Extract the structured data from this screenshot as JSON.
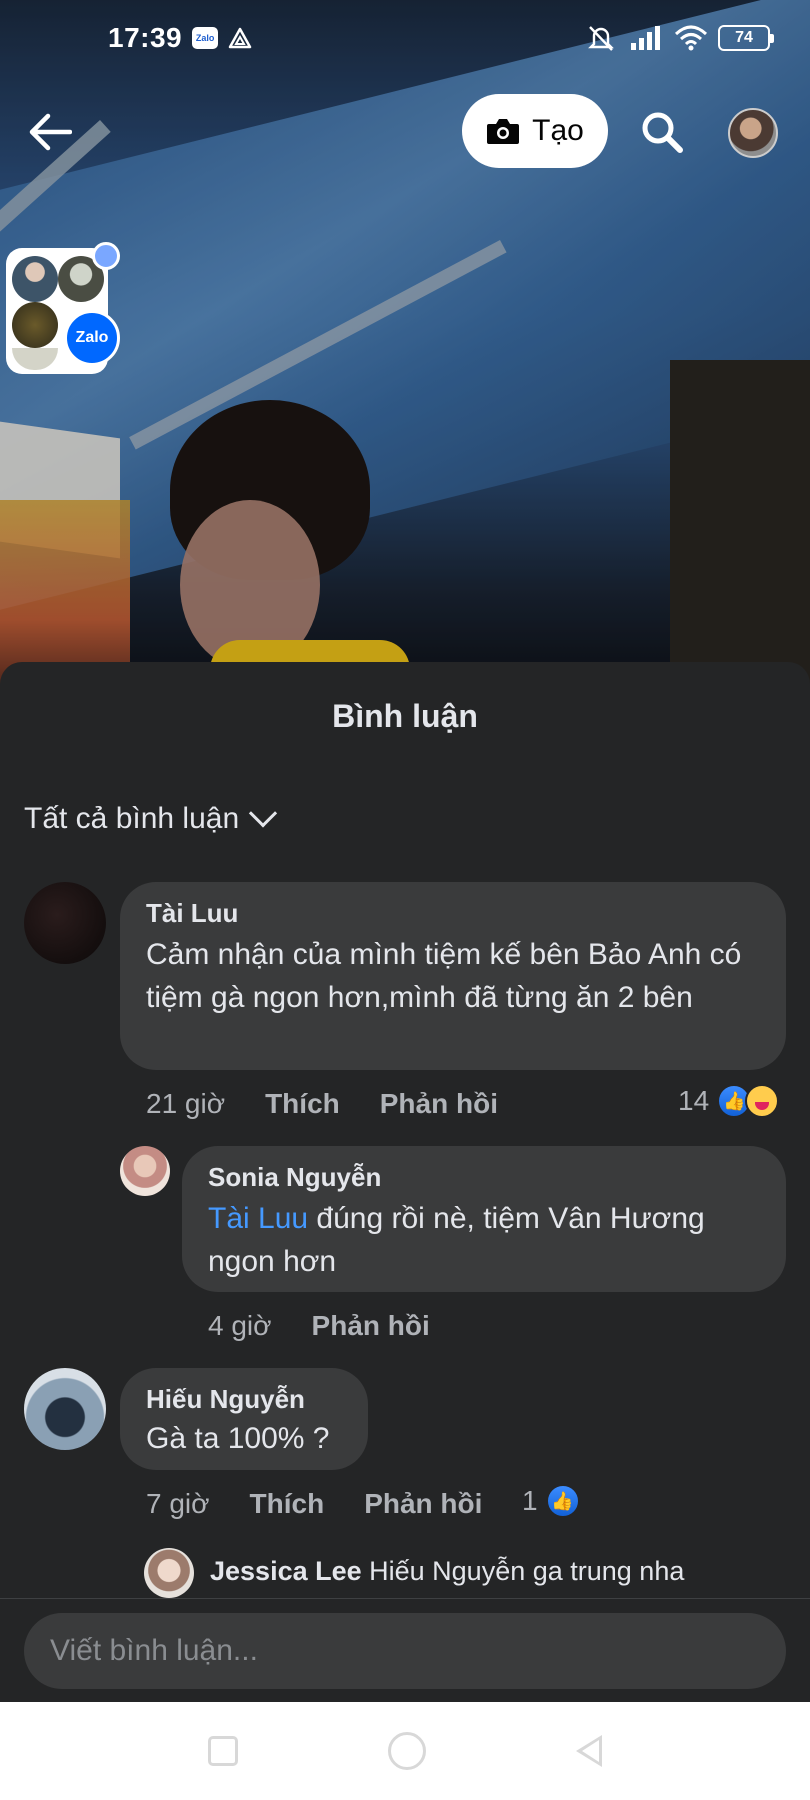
{
  "status_bar": {
    "time": "17:39",
    "app_badge": "Zalo",
    "battery": "74"
  },
  "top_bar": {
    "create_label": "Tạo"
  },
  "chat_bubble": {
    "label": "Zalo"
  },
  "comments_sheet": {
    "title": "Bình luận",
    "filter_label": "Tất cả bình luận",
    "comments": [
      {
        "author": "Tài Luu",
        "text": "Cảm nhận của mình tiệm kế bên Bảo Anh có tiệm gà ngon hơn,mình đã từng ăn 2 bên",
        "time": "21 giờ",
        "like_label": "Thích",
        "reply_label": "Phản hồi",
        "reaction_count": "14",
        "replies": [
          {
            "author": "Sonia Nguyễn",
            "mention": "Tài Luu",
            "text": " đúng rồi nè, tiệm Vân Hương ngon hơn",
            "time": "4 giờ",
            "reply_label": "Phản hồi"
          }
        ]
      },
      {
        "author": "Hiếu Nguyễn",
        "text": "Gà ta 100% ?",
        "time": "7 giờ",
        "like_label": "Thích",
        "reply_label": "Phản hồi",
        "reaction_count": "1",
        "reply_preview": {
          "author": "Jessica Lee",
          "text": " Hiếu Nguyễn ga trung nha"
        }
      }
    ],
    "composer_placeholder": "Viết bình luận..."
  },
  "colors": {
    "sheet_bg": "#242526",
    "bubble_bg": "#3a3b3c",
    "mention": "#4599ff",
    "like_blue": "#1877f2"
  }
}
